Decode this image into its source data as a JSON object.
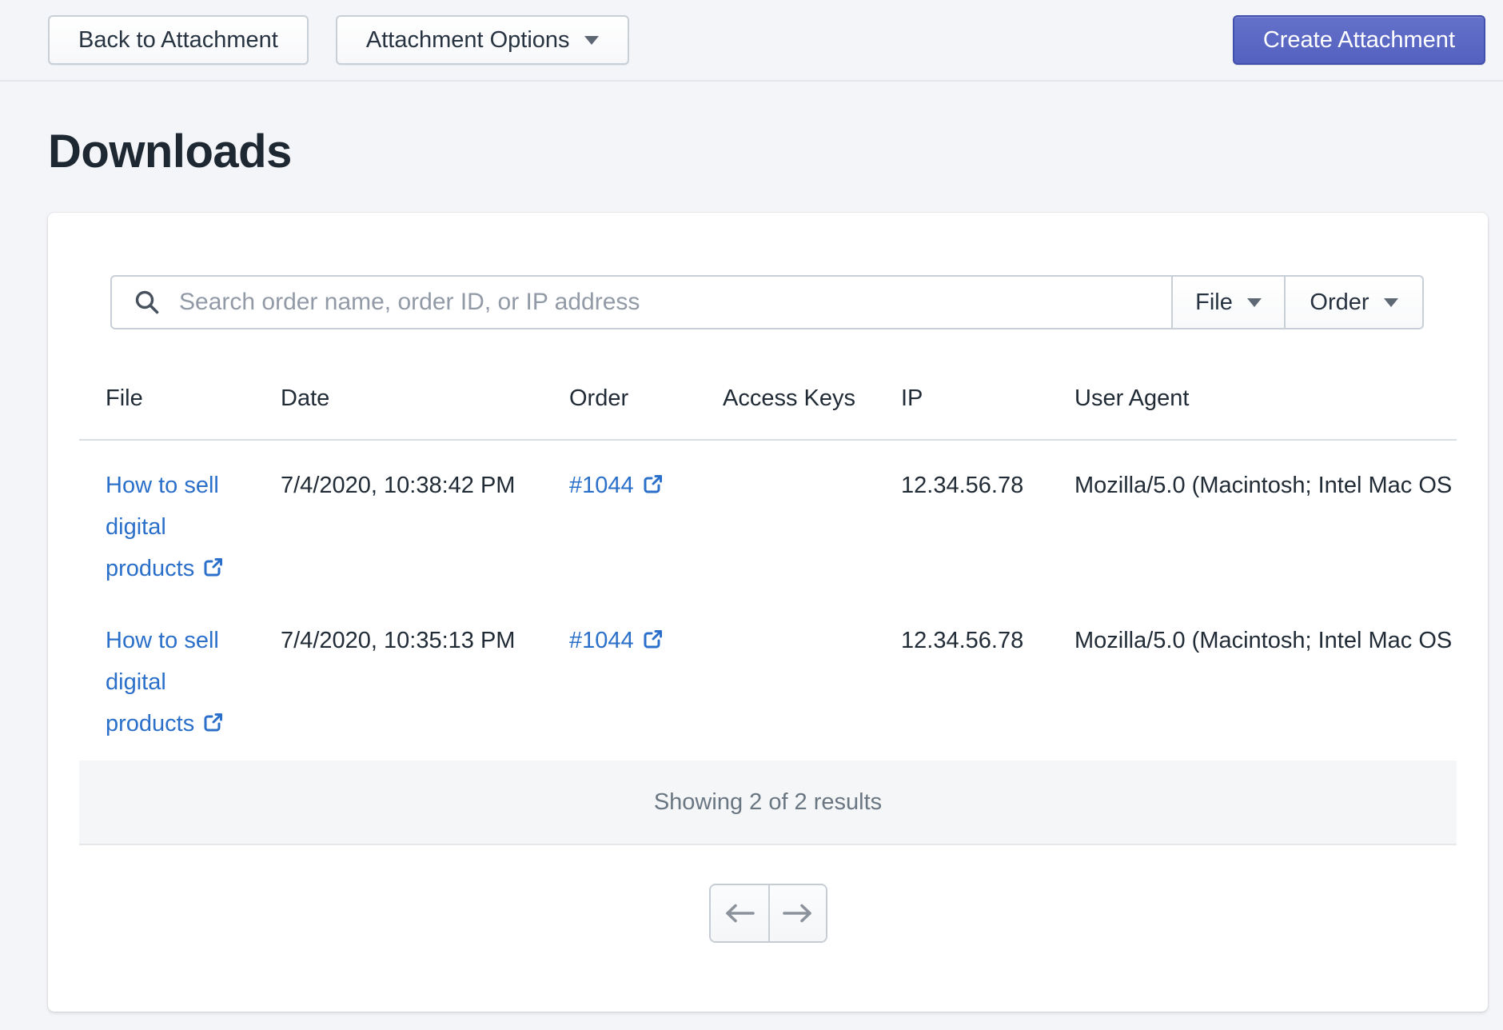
{
  "topbar": {
    "back_label": "Back to Attachment",
    "options_label": "Attachment Options",
    "create_label": "Create Attachment"
  },
  "page": {
    "title": "Downloads"
  },
  "filters": {
    "search_placeholder": "Search order name, order ID, or IP address",
    "file_filter_label": "File",
    "order_filter_label": "Order"
  },
  "table": {
    "columns": [
      "File",
      "Date",
      "Order",
      "Access Keys",
      "IP",
      "User Agent"
    ],
    "rows": [
      {
        "file": "How to sell digital products",
        "date": "7/4/2020, 10:38:42 PM",
        "order": "#1044",
        "access_keys": "",
        "ip": "12.34.56.78",
        "user_agent": "Mozilla/5.0 (Macintosh; Intel Mac OS"
      },
      {
        "file": "How to sell digital products",
        "date": "7/4/2020, 10:35:13 PM",
        "order": "#1044",
        "access_keys": "",
        "ip": "12.34.56.78",
        "user_agent": "Mozilla/5.0 (Macintosh; Intel Mac OS"
      }
    ],
    "summary": "Showing 2 of 2 results"
  },
  "icons": {
    "search": "magnifier",
    "external": "external-link",
    "caret": "caret-down",
    "prev": "arrow-left",
    "next": "arrow-right"
  },
  "colors": {
    "primary": "#5c6ac4",
    "link": "#2a6fc9",
    "text": "#212b36",
    "muted": "#6a7682",
    "page_background": "#f4f5f8"
  }
}
